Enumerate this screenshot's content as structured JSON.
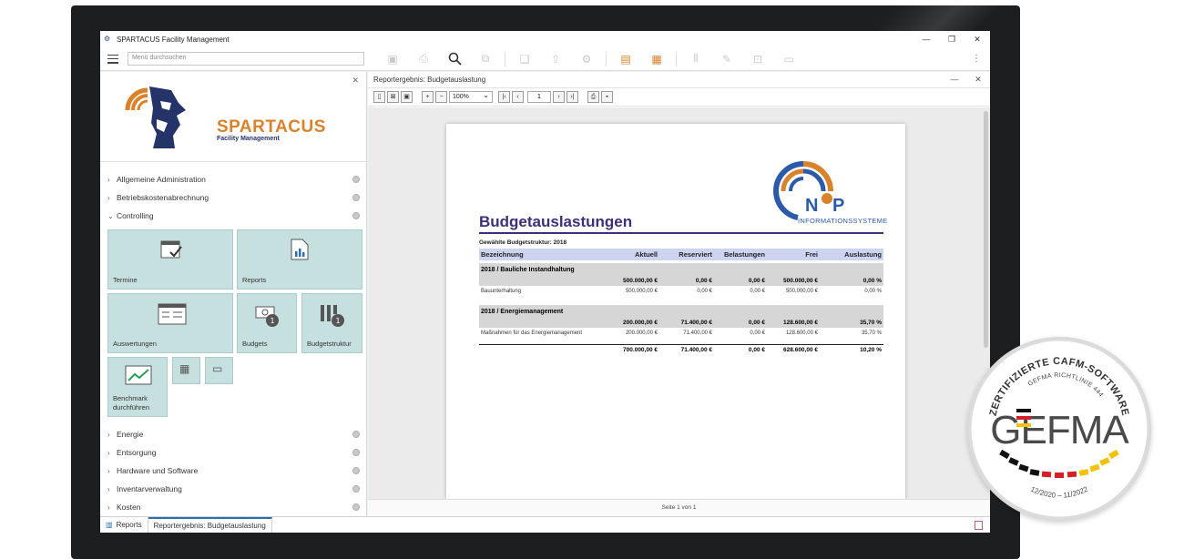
{
  "window": {
    "title": "SPARTACUS Facility Management",
    "controls": [
      "—",
      "❐",
      "✕"
    ]
  },
  "toolbar": {
    "search_placeholder": "Menü durchsuchen",
    "more": "⋮"
  },
  "sidebar": {
    "brand": "SPARTACUS",
    "brand_sub": "Facility Management",
    "nav_top": [
      "Allgemeine Administration",
      "Betriebskostenabrechnung",
      "Controlling"
    ],
    "tiles": {
      "termine": "Termine",
      "reports": "Reports",
      "auswertungen": "Auswertungen",
      "budgets": "Budgets",
      "budgetstruktur": "Budgetstruktur",
      "benchmark": "Benchmark durchführen"
    },
    "nav_bottom": [
      "Energie",
      "Entsorgung",
      "Hardware und Software",
      "Inventarverwaltung",
      "Kosten"
    ]
  },
  "content": {
    "title": "Reportergebnis: Budgetauslastung",
    "zoom": "100%",
    "page": "1",
    "footer": "Seite 1 von 1"
  },
  "report": {
    "title": "Budgetauslastungen",
    "logo_text": "INFORMATIONSSYSTEME",
    "structure_label": "Gewählte Budgetstruktur: 2018",
    "columns": [
      "Bezeichnung",
      "Aktuell",
      "Reserviert",
      "Belastungen",
      "Frei",
      "Auslastung"
    ],
    "groups": [
      {
        "name": "2018 / Bauliche Instandhaltung",
        "sum": [
          "500.000,00 €",
          "0,00 €",
          "0,00 €",
          "500.000,00 €",
          "0,00 %"
        ],
        "rows": [
          {
            "label": "Bauunterhaltung",
            "values": [
              "500.000,00 €",
              "0,00 €",
              "0,00 €",
              "500.000,00 €",
              "0,00 %"
            ]
          }
        ]
      },
      {
        "name": "2018 / Energiemanagement",
        "sum": [
          "200.000,00 €",
          "71.400,00 €",
          "0,00 €",
          "128.600,00 €",
          "35,70 %"
        ],
        "rows": [
          {
            "label": "Maßnahmen für das Energiemanagement",
            "values": [
              "200.000,00 €",
              "71.400,00 €",
              "0,00 €",
              "128.600,00 €",
              "35,70 %"
            ]
          }
        ]
      }
    ],
    "total": [
      "700.000,00 €",
      "71.400,00 €",
      "0,00 €",
      "628.600,00 €",
      "10,20 %"
    ]
  },
  "statusbar": {
    "tabs": [
      "Reports",
      "Reportergebnis: Budgetauslastung"
    ]
  },
  "badge": {
    "top_text": "ZERTIFIZIERTE CAFM-SOFTWARE",
    "sub_text": "GEFMA RICHTLINIE 444",
    "brand": "GEFMA",
    "dates": "12/2020 – 11/2022"
  }
}
